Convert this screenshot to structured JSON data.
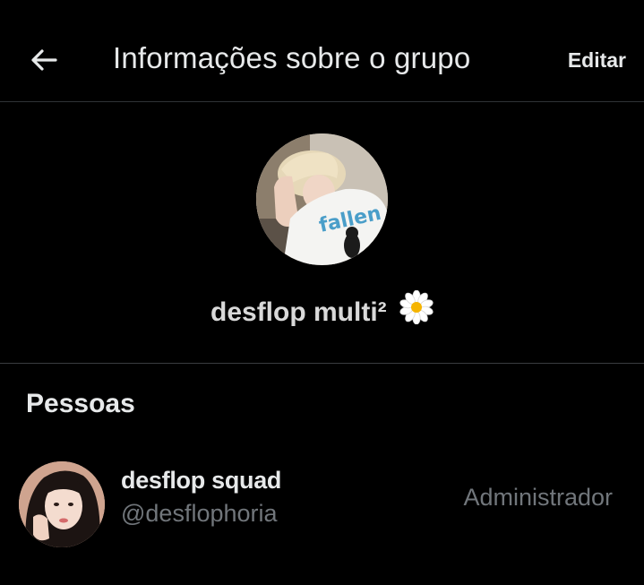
{
  "header": {
    "title": "Informações sobre o grupo",
    "edit_label": "Editar",
    "back_icon": "arrow-left-icon"
  },
  "group": {
    "name": "desflop multi²",
    "emoji_icon": "daisy-flower-icon"
  },
  "people": {
    "heading": "Pessoas",
    "members": [
      {
        "name": "desflop squad",
        "handle": "@desflophoria",
        "role": "Administrador"
      }
    ]
  },
  "colors": {
    "background": "#000000",
    "text_primary": "#e7e9ea",
    "text_secondary": "#71767b",
    "divider": "#2f3336"
  }
}
